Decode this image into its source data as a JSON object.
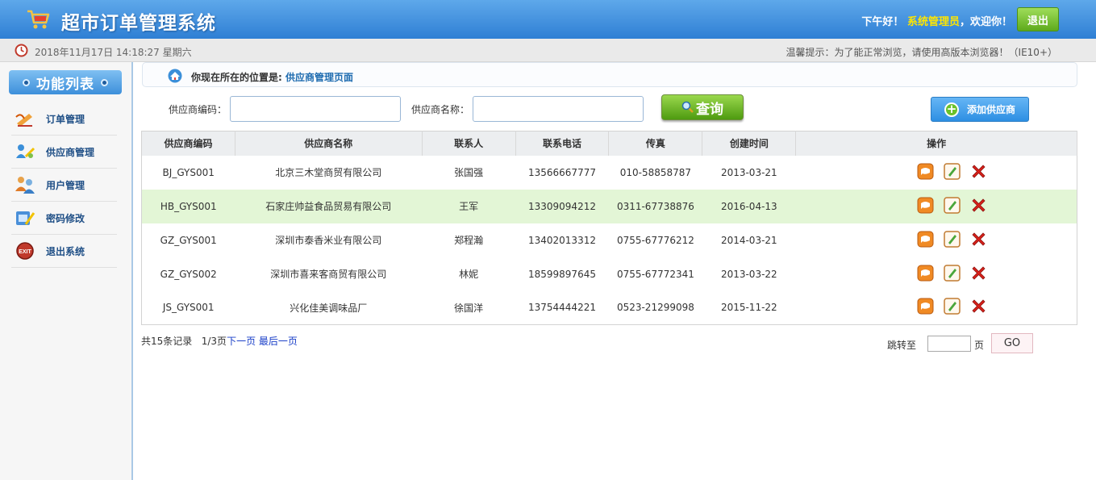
{
  "header": {
    "app_title": "超市订单管理系统",
    "greeting": "下午好！",
    "role": "系统管理员",
    "welcome": "，欢迎你！",
    "logout_label": "退出"
  },
  "statusbar": {
    "datetime": "2018年11月17日 14:18:27 星期六",
    "tip": "温馨提示：为了能正常浏览，请使用高版本浏览器！（IE10+）"
  },
  "sidebar": {
    "title": "功能列表",
    "items": [
      {
        "label": "订单管理",
        "icon": "order-icon"
      },
      {
        "label": "供应商管理",
        "icon": "provider-icon"
      },
      {
        "label": "用户管理",
        "icon": "users-icon"
      },
      {
        "label": "密码修改",
        "icon": "password-icon"
      },
      {
        "label": "退出系统",
        "icon": "exit-icon"
      }
    ]
  },
  "breadcrumb": {
    "prefix": "你现在所在的位置是:",
    "current": "供应商管理页面"
  },
  "search": {
    "code_label": "供应商编码：",
    "code_value": "",
    "name_label": "供应商名称：",
    "name_value": "",
    "query_label": "查询",
    "add_label": "添加供应商"
  },
  "table": {
    "headers": [
      "供应商编码",
      "供应商名称",
      "联系人",
      "联系电话",
      "传真",
      "创建时间",
      "操作"
    ],
    "rows": [
      [
        "BJ_GYS001",
        "北京三木堂商贸有限公司",
        "张国强",
        "13566667777",
        "010-58858787",
        "2013-03-21"
      ],
      [
        "HB_GYS001",
        "石家庄帅益食品贸易有限公司",
        "王军",
        "13309094212",
        "0311-67738876",
        "2016-04-13"
      ],
      [
        "GZ_GYS001",
        "深圳市泰香米业有限公司",
        "郑程瀚",
        "13402013312",
        "0755-67776212",
        "2014-03-21"
      ],
      [
        "GZ_GYS002",
        "深圳市喜来客商贸有限公司",
        "林妮",
        "18599897645",
        "0755-67772341",
        "2013-03-22"
      ],
      [
        "JS_GYS001",
        "兴化佳美调味品厂",
        "徐国洋",
        "13754444221",
        "0523-21299098",
        "2015-11-22"
      ]
    ]
  },
  "pager": {
    "total": "共15条记录",
    "page": "1/3页",
    "next": "下一页",
    "last": "最后一页",
    "jump_label": "跳转至",
    "jump_value": "",
    "page_unit": "页",
    "go_label": "GO"
  },
  "colors": {
    "header_blue": "#2f7fd4",
    "role_yellow": "#ffe600",
    "highlight_row": "#e3f6d6",
    "link_blue": "#1a3fc8"
  }
}
